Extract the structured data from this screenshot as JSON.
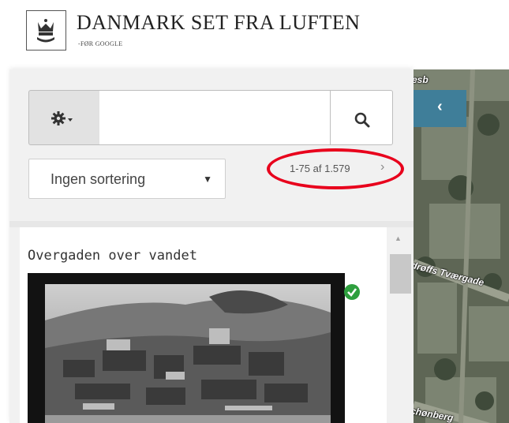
{
  "header": {
    "title": "DANMARK SET FRA LUFTEN",
    "subtitle": "-FØR GOOGLE",
    "logo_icon": "crown-crest-icon"
  },
  "search": {
    "settings_icon": "gear-dropdown-icon",
    "value": "",
    "placeholder": "",
    "search_icon": "search-icon"
  },
  "sort": {
    "selected": "Ingen sortering",
    "caret": "▼"
  },
  "pager": {
    "text": "1-75 af 1.579",
    "next_symbol": "›"
  },
  "results": [
    {
      "title": "Overgaden over vandet",
      "selected": true
    }
  ],
  "map": {
    "collapse_symbol": "‹",
    "labels": [
      "esb",
      "drøffs Tværgade",
      "chønberg"
    ]
  },
  "colors": {
    "highlight": "#e8001c",
    "collapse_button": "#3f7e99",
    "check": "#2e9f3e"
  }
}
